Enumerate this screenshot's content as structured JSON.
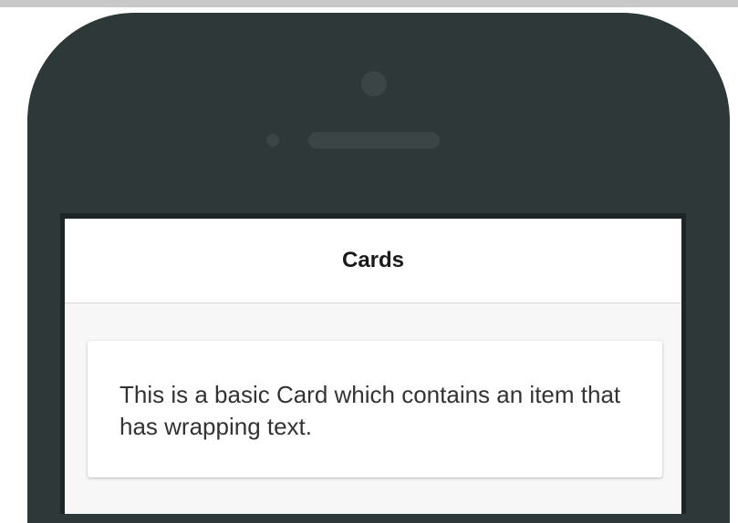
{
  "header": {
    "title": "Cards"
  },
  "card": {
    "text": "This is a basic Card which contains an item that has wrapping text."
  },
  "colors": {
    "device_frame": "#2f3839",
    "header_background": "#ffffff",
    "content_background": "#f7f7f7",
    "card_background": "#ffffff",
    "text": "#333333"
  }
}
